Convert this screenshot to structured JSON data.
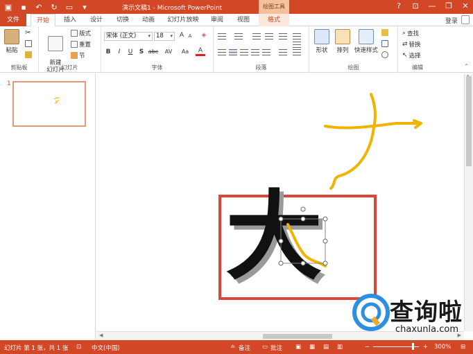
{
  "titlebar": {
    "title": "演示文稿1 - Microsoft PowerPoint",
    "tool_context": "绘图工具",
    "help": "?"
  },
  "tabs": {
    "file": "文件",
    "items": [
      "开始",
      "插入",
      "设计",
      "切换",
      "动画",
      "幻灯片放映",
      "审阅",
      "视图"
    ],
    "format": "格式",
    "login": "登录"
  },
  "ribbon": {
    "clipboard": {
      "label": "剪贴板",
      "paste": "粘贴"
    },
    "slides": {
      "label": "幻灯片",
      "new_slide": "新建\n幻灯片",
      "layout": "版式",
      "reset": "重置",
      "section": "节"
    },
    "font": {
      "label": "字体",
      "font_name": "宋体 (正文)",
      "font_size": "18",
      "bold": "B",
      "italic": "I",
      "underline": "U",
      "shadow": "S",
      "strike": "abc",
      "spacing": "AV",
      "case": "Aa",
      "color": "A",
      "grow": "A",
      "shrink": "A"
    },
    "paragraph": {
      "label": "段落"
    },
    "drawing": {
      "label": "绘图",
      "shapes": "形状",
      "arrange": "排列",
      "quick_styles": "快速样式"
    },
    "editing": {
      "label": "编辑",
      "find": "查找",
      "replace": "替换",
      "select": "选择"
    }
  },
  "thumbs": {
    "slide_number": "1"
  },
  "slide": {
    "character": "大"
  },
  "status": {
    "slide_info": "幻灯片 第 1 张，共 1 张",
    "language": "中文(中国)",
    "notes": "备注",
    "comments": "批注",
    "zoom": "300%"
  },
  "watermark": {
    "brand": "查询啦",
    "url": "chaxunla.com"
  },
  "colors": {
    "accent": "#d24726",
    "ink": "#f0b400",
    "box": "#d9473a"
  }
}
